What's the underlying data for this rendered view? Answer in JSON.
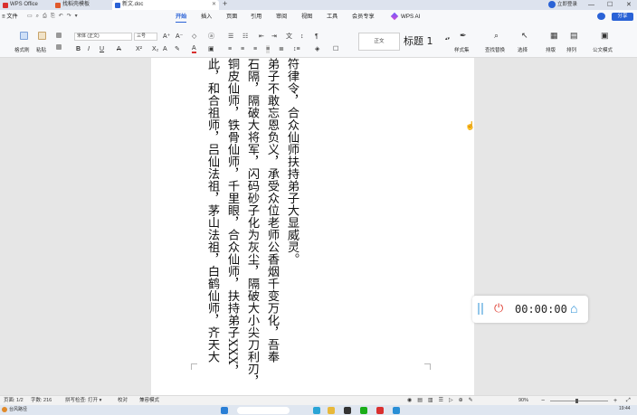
{
  "tabs": [
    {
      "label": "WPS Office",
      "color": "#d9302f"
    },
    {
      "label": "找稻壳模板",
      "color": "#e05a2b"
    },
    {
      "label": "新文.doc",
      "color": "#2a62d6"
    }
  ],
  "titlebar": {
    "new_tab": "+",
    "user": "立即登录"
  },
  "menu": {
    "file": "≡ 文件",
    "items": [
      "开始",
      "插入",
      "页面",
      "引用",
      "审阅",
      "视图",
      "工具",
      "会员专享",
      "WPS AI"
    ],
    "share": "分享"
  },
  "toolbar": {
    "format_painter": "格式刷",
    "paste": "粘贴",
    "font_name": "宋体 (正文)",
    "font_size": "三号",
    "style_normal": "正文",
    "style_heading": "标题 1",
    "styles": "样式集",
    "find_replace": "查找替换",
    "select": "选择",
    "layout": "排版",
    "sort": "排列",
    "doc_format": "公文模式"
  },
  "document": {
    "columns": [
      "符律令，合众仙师扶持弟子大显威灵。",
      "弟子不敢忘恩负义，承受众位老师公香烟千变万化，吾奉",
      "石隔，隔破大将军，闪码砂子化为灰尘，隔破大小尖刀利刃，",
      "铜皮仙师，铁骨仙师，千里眼，合众仙师，扶持弟子XXX，",
      "此，和合祖师，吕仙法祖，茅山法祖，白鹤仙师，齐天大"
    ]
  },
  "recorder": {
    "time": "00:00:00"
  },
  "statusbar": {
    "page": "页面: 1/2",
    "words": "字数: 216",
    "spell": "拼写检查: 打开 ▾",
    "proofread": "校对",
    "compat": "兼容模式",
    "zoom": "90%"
  },
  "taskbar": {
    "time": "19:44",
    "search": "台风路径"
  },
  "colors": {
    "accent": "#2a62d6",
    "record_red": "#e0453a",
    "pause_blue": "#2a8fd6"
  }
}
